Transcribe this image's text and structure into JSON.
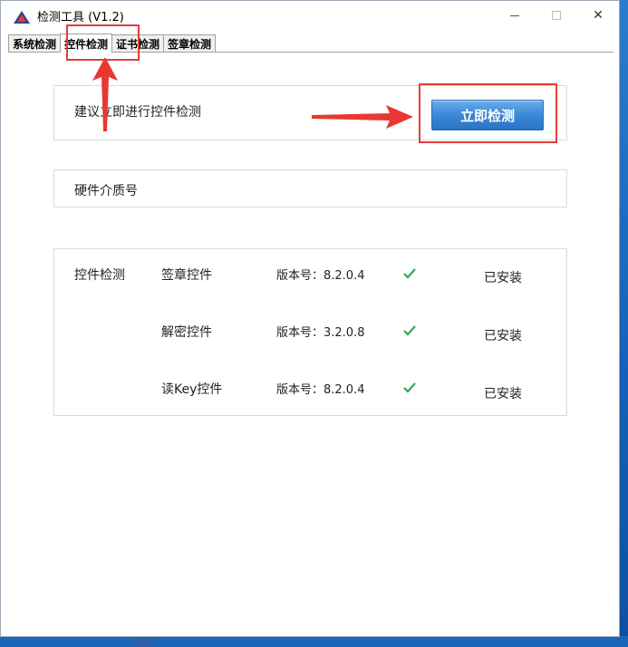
{
  "window": {
    "title": "检测工具 (V1.2)",
    "controls": {
      "minimize": "minimize",
      "maximize": "maximize",
      "close": "✕"
    }
  },
  "tabs": [
    {
      "label": "系统检测",
      "active": false
    },
    {
      "label": "控件检测",
      "active": true
    },
    {
      "label": "证书检测",
      "active": false
    },
    {
      "label": "签章检测",
      "active": false
    }
  ],
  "main": {
    "suggest_text": "建议立即进行控件检测",
    "detect_button": "立即检测",
    "serial_label": "硬件介质号",
    "controls_section_label": "控件检测",
    "controls": [
      {
        "name": "签章控件",
        "version": "版本号：8.2.0.4",
        "status": "已安装"
      },
      {
        "name": "解密控件",
        "version": "版本号：3.2.0.8",
        "status": "已安装"
      },
      {
        "name": "读Key控件",
        "version": "版本号：8.2.0.4",
        "status": "已安装"
      }
    ]
  },
  "colors": {
    "accent_button": "#3a88d6",
    "annotation_red": "#e23d35",
    "check_green": "#3aa655"
  },
  "icons": {
    "app": "triangle-logo-icon",
    "check": "check-icon",
    "arrow_up": "red-arrow-up",
    "arrow_right": "red-arrow-right"
  }
}
